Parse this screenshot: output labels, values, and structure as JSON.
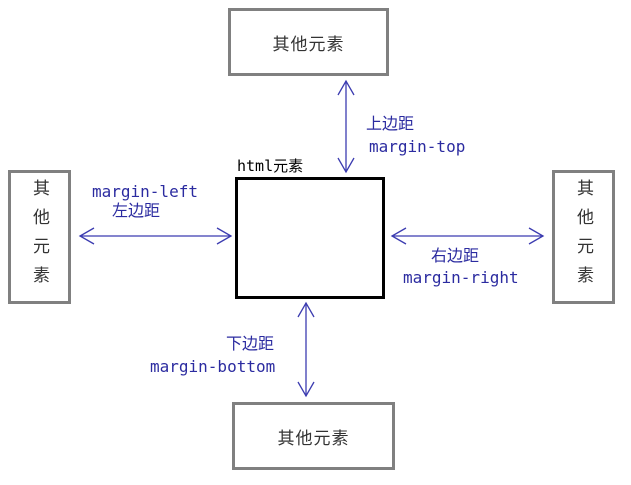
{
  "other_element_label": "其他元素",
  "html_element_label": "html元素",
  "margins": {
    "top": {
      "cn": "上边距",
      "en": "margin-top"
    },
    "left": {
      "cn": "左边距",
      "en": "margin-left"
    },
    "right": {
      "cn": "右边距",
      "en": "margin-right"
    },
    "bottom": {
      "cn": "下边距",
      "en": "margin-bottom"
    }
  },
  "colors": {
    "arrow": "#3b3bb0",
    "label": "#2b2ba0",
    "box_border": "#808080",
    "html_border": "#000000"
  }
}
